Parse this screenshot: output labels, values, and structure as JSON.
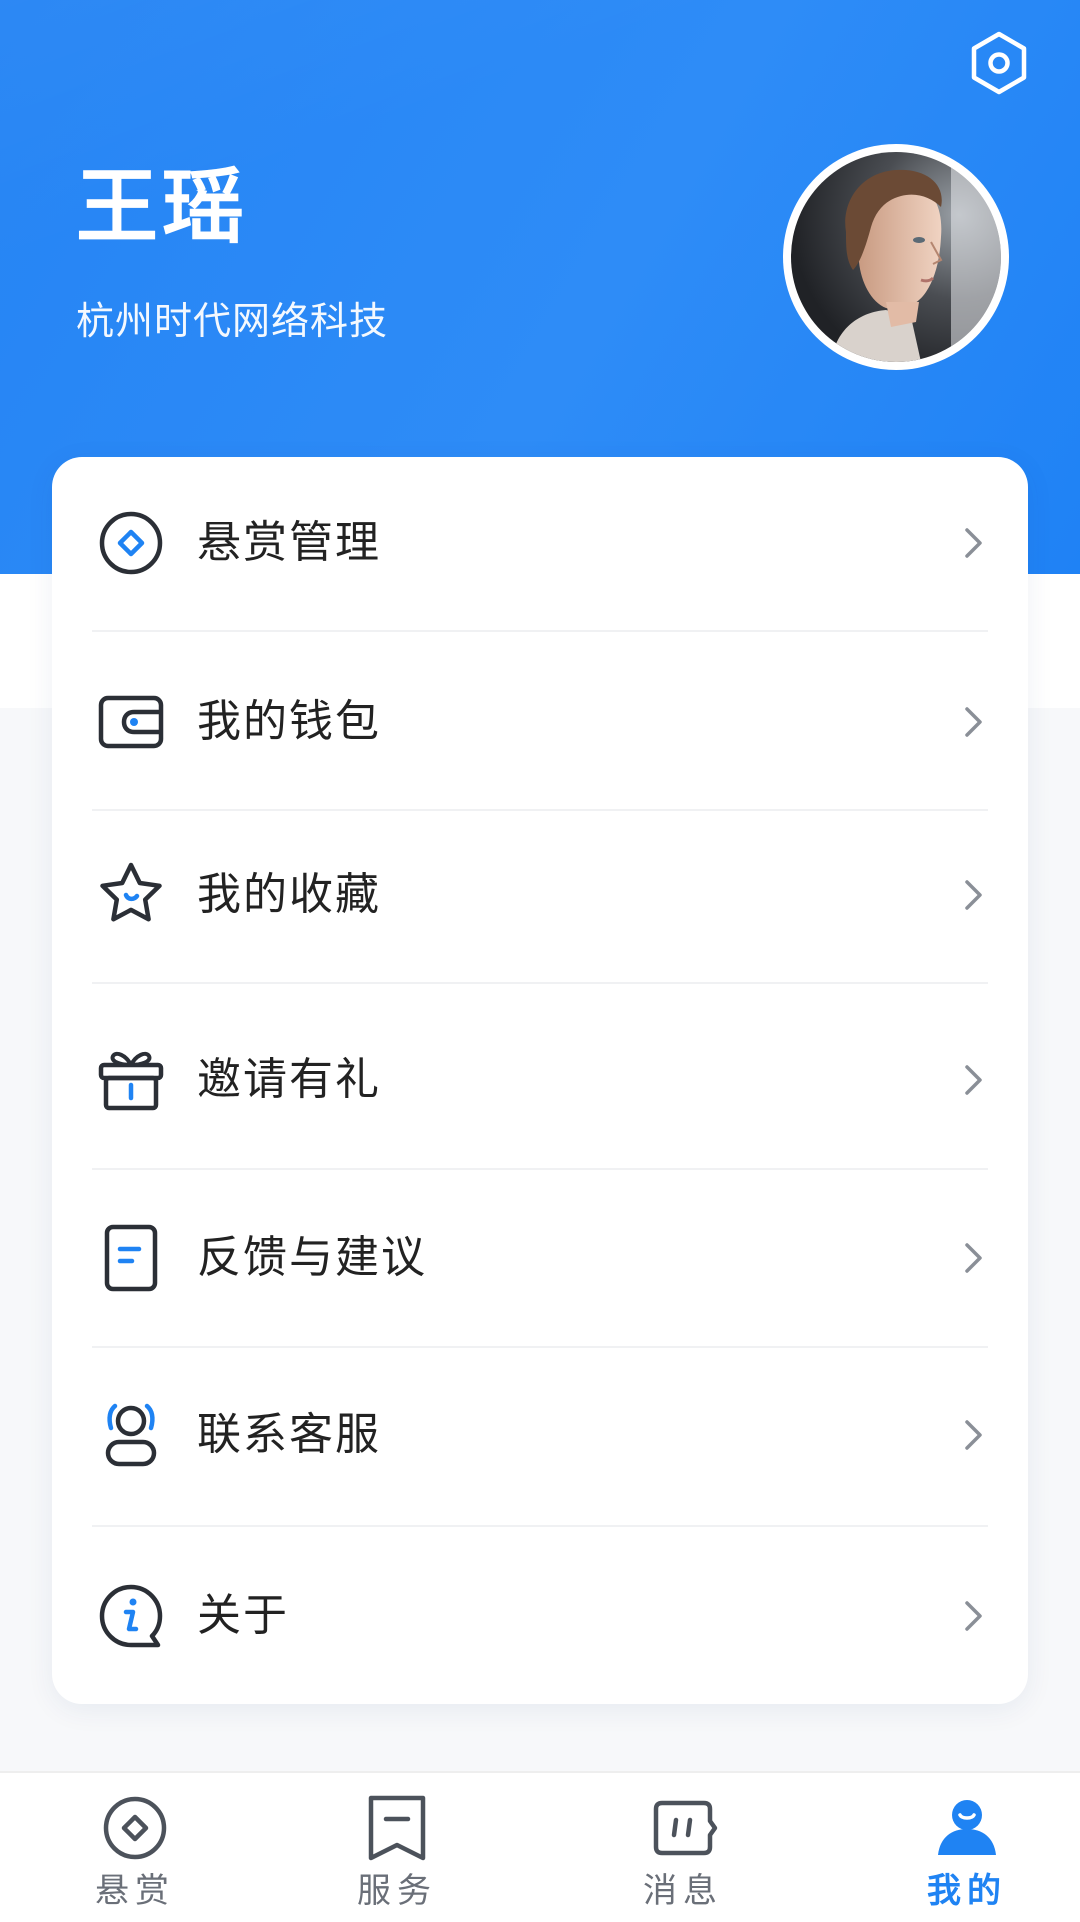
{
  "profile": {
    "name": "王瑶",
    "company": "杭州时代网络科技"
  },
  "colors": {
    "primary": "#1f83f3",
    "icon_dark": "#2b2f36",
    "text": "#222222",
    "muted": "#6a6f78"
  },
  "menu": {
    "items": [
      {
        "label": "悬赏管理",
        "icon": "diamond-coin-icon"
      },
      {
        "label": "我的钱包",
        "icon": "wallet-icon"
      },
      {
        "label": "我的收藏",
        "icon": "star-icon"
      },
      {
        "label": "邀请有礼",
        "icon": "gift-icon"
      },
      {
        "label": "反馈与建议",
        "icon": "feedback-document-icon"
      },
      {
        "label": "联系客服",
        "icon": "customer-service-icon"
      },
      {
        "label": "关于",
        "icon": "info-icon"
      }
    ]
  },
  "tabbar": {
    "active": "我的",
    "items": [
      {
        "label": "悬赏",
        "icon": "diamond-coin-icon"
      },
      {
        "label": "服务",
        "icon": "bookmark-icon"
      },
      {
        "label": "消息",
        "icon": "message-bubble-icon"
      },
      {
        "label": "我的",
        "icon": "user-icon"
      }
    ]
  }
}
